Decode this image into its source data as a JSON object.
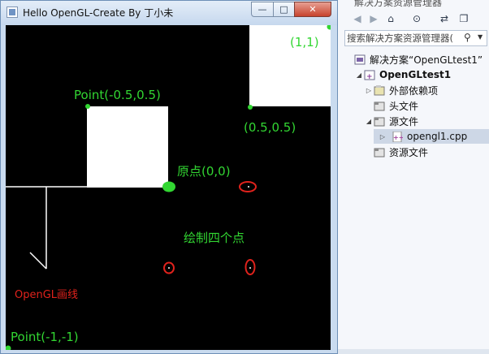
{
  "window": {
    "title": "Hello OpenGL-Create By 丁小未",
    "min_icon": "minimize-icon",
    "max_icon": "maximize-icon",
    "close_icon": "close-icon",
    "min_glyph": "—",
    "max_glyph": "□",
    "close_glyph": "✕"
  },
  "canvas": {
    "labels": {
      "top_right": "(1,1)",
      "top_left_point": "Point(-0.5,0.5)",
      "mid_point": "(0.5,0.5)",
      "origin": "原点(0,0)",
      "draw_points": "绘制四个点",
      "opengl_line": "OpenGL画线",
      "bottom_left": "Point(-1,-1)"
    },
    "colors": {
      "background": "#000000",
      "rect": "#ffffff",
      "point": "#32d632",
      "marker": "#e0221c",
      "line": "#ffffff"
    }
  },
  "solution_explorer": {
    "header": "解决方案资源管理器",
    "search_placeholder": "搜索解决方案资源管理器(",
    "toolbar_icons": [
      "back-icon",
      "forward-icon",
      "home-icon",
      "history-icon",
      "sync-icon",
      "windows-icon"
    ],
    "toolbar_glyphs": [
      "◀",
      "▶",
      "⌂",
      "⊙",
      "⇄",
      "❐"
    ],
    "search_icon_glyph": "⚲",
    "search_drop_glyph": "▼",
    "tree": {
      "solution": "解决方案“OpenGLtest1”",
      "project": "OpenGLtest1",
      "external_deps": "外部依赖项",
      "headers": "头文件",
      "sources": "源文件",
      "file": "opengl1.cpp",
      "resources": "资源文件"
    }
  }
}
